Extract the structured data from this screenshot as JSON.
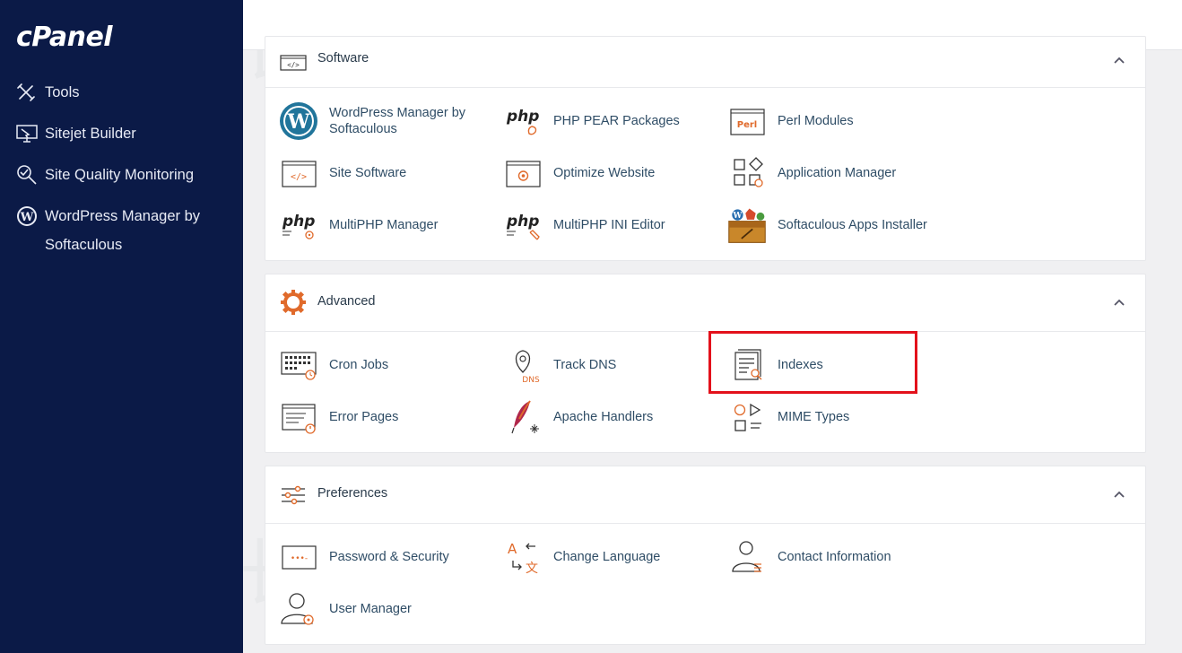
{
  "sidebar": {
    "logo": "cPanel",
    "items": [
      {
        "label": "Tools",
        "icon": "tools-icon"
      },
      {
        "label": "Sitejet Builder",
        "icon": "sitejet-icon"
      },
      {
        "label": "Site Quality Monitoring",
        "icon": "site-quality-icon"
      },
      {
        "label": "WordPress Manager by Softaculous",
        "icon": "wordpress-icon"
      }
    ]
  },
  "watermark": "站长百科",
  "sections": {
    "software": {
      "title": "Software",
      "items": [
        {
          "label": "WordPress Manager by Softaculous",
          "icon": "wordpress-icon"
        },
        {
          "label": "PHP PEAR Packages",
          "icon": "php-pear-icon"
        },
        {
          "label": "Perl Modules",
          "icon": "perl-icon"
        },
        {
          "label": "Site Software",
          "icon": "code-window-icon"
        },
        {
          "label": "Optimize Website",
          "icon": "optimize-icon"
        },
        {
          "label": "Application Manager",
          "icon": "app-manager-icon"
        },
        {
          "label": "MultiPHP Manager",
          "icon": "multiphp-manager-icon"
        },
        {
          "label": "MultiPHP INI Editor",
          "icon": "multiphp-ini-icon"
        },
        {
          "label": "Softaculous Apps Installer",
          "icon": "softaculous-icon"
        }
      ]
    },
    "advanced": {
      "title": "Advanced",
      "items": [
        {
          "label": "Cron Jobs",
          "icon": "cron-icon"
        },
        {
          "label": "Track DNS",
          "icon": "track-dns-icon",
          "badge": "DNS"
        },
        {
          "label": "Indexes",
          "icon": "indexes-icon"
        },
        {
          "label": "Error Pages",
          "icon": "error-pages-icon"
        },
        {
          "label": "Apache Handlers",
          "icon": "apache-feather-icon"
        },
        {
          "label": "MIME Types",
          "icon": "mime-icon"
        }
      ]
    },
    "preferences": {
      "title": "Preferences",
      "items": [
        {
          "label": "Password & Security",
          "icon": "password-icon"
        },
        {
          "label": "Change Language",
          "icon": "language-icon"
        },
        {
          "label": "Contact Information",
          "icon": "contact-icon"
        },
        {
          "label": "User Manager",
          "icon": "user-manager-icon"
        }
      ]
    }
  },
  "icon_text": {
    "php": "php",
    "perl": "Perl",
    "code": "</>",
    "lang_a": "A",
    "lang_zh": "文",
    "dots": "•••-"
  },
  "colors": {
    "sidebar_bg": "#0b1a47",
    "accent_orange": "#e06a2b",
    "highlight_red": "#e3111b",
    "link_text": "#2f4d66"
  }
}
